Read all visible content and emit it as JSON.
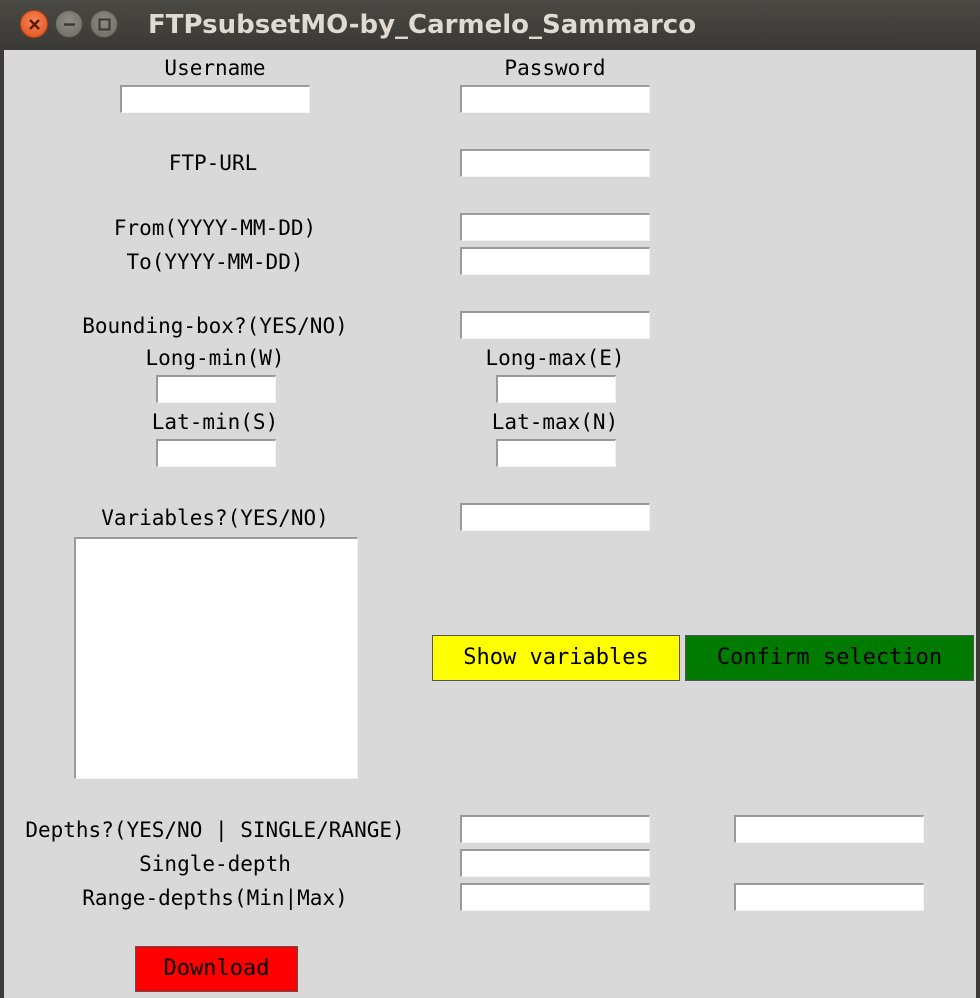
{
  "window": {
    "title": "FTPsubsetMO-by_Carmelo_Sammarco"
  },
  "form": {
    "username_label": "Username",
    "password_label": "Password",
    "ftp_url_label": "FTP-URL",
    "from_label": "From(YYYY-MM-DD)",
    "to_label": "To(YYYY-MM-DD)",
    "bbox_label": "Bounding-box?(YES/NO)",
    "long_min_label": "Long-min(W)",
    "long_max_label": "Long-max(E)",
    "lat_min_label": "Lat-min(S)",
    "lat_max_label": "Lat-max(N)",
    "variables_label": "Variables?(YES/NO)",
    "depths_label": "Depths?(YES/NO | SINGLE/RANGE)",
    "single_depth_label": "Single-depth",
    "range_depths_label": "Range-depths(Min|Max)"
  },
  "fields": {
    "username": "",
    "password": "",
    "ftp_url": "",
    "from_date": "",
    "to_date": "",
    "bbox": "",
    "long_min": "",
    "long_max": "",
    "lat_min": "",
    "lat_max": "",
    "variables": "",
    "depths_yes_no": "",
    "depths_single_range": "",
    "single_depth": "",
    "range_min": "",
    "range_max": ""
  },
  "variables_list": [],
  "buttons": {
    "show_variables": "Show variables",
    "confirm_selection": "Confirm selection",
    "download": "Download"
  },
  "colors": {
    "show_variables_bg": "#ffff00",
    "confirm_selection_bg": "#007a00",
    "download_bg": "#ff0000",
    "window_bg": "#d9d9d9"
  }
}
